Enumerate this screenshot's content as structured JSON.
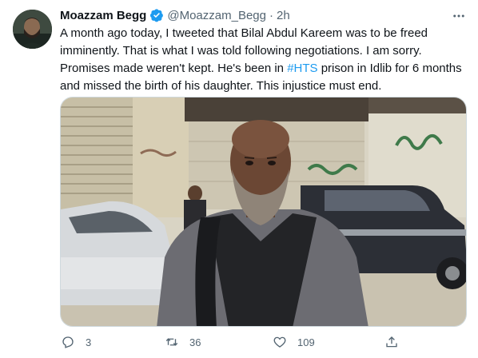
{
  "tweet": {
    "author": {
      "display_name": "Moazzam Begg",
      "handle": "@Moazzam_Begg",
      "verified_icon": "verified-badge-icon",
      "avatar_icon": "profile-avatar"
    },
    "separator": "·",
    "timestamp": "2h",
    "text": {
      "before_hashtag": "A month ago today, I tweeted that Bilal Abdul Kareem was to be freed imminently. That is what I was told following negotiations. I am sorry. Promises made weren't kept. He's been in ",
      "hashtag": "#HTS",
      "after_hashtag": " prison in Idlib for 6 months and missed the birth of his daughter. This injustice must end."
    },
    "media": {
      "type": "photo",
      "description_icon": "photo-man-standing-street"
    },
    "actions": {
      "reply_count": "3",
      "retweet_count": "36",
      "like_count": "109"
    }
  },
  "colors": {
    "text": "#0f1419",
    "secondary": "#536471",
    "link": "#1d9bf0",
    "verified": "#1d9bf0"
  }
}
